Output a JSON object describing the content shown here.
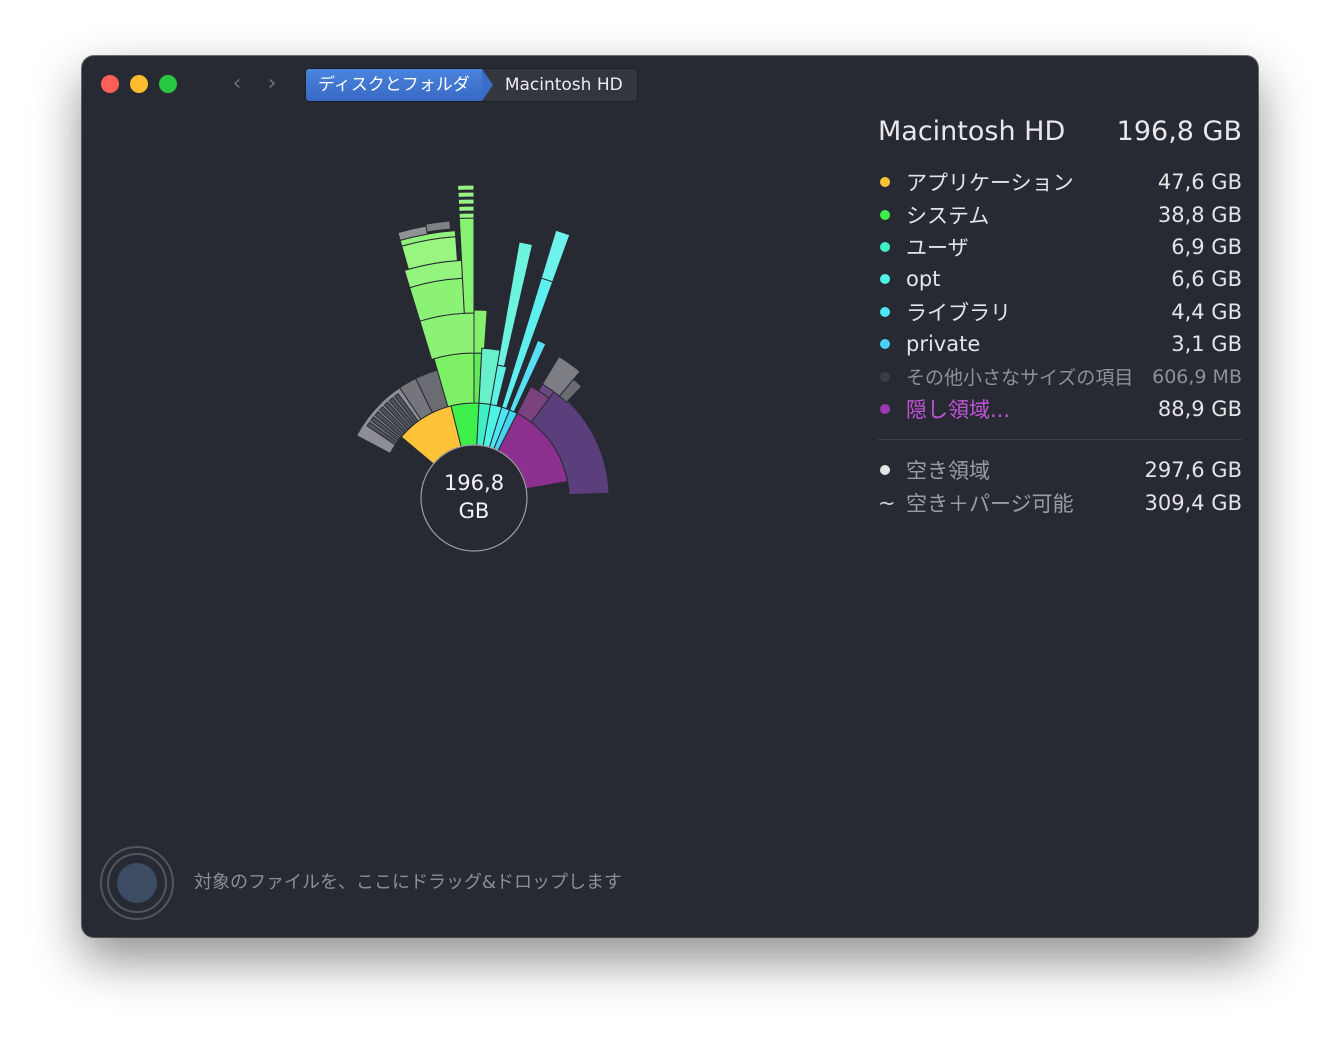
{
  "breadcrumb": {
    "root_label": "ディスクとフォルダ",
    "current_label": "Macintosh HD"
  },
  "chart": {
    "center_value": "196,8",
    "center_unit": "GB"
  },
  "panel": {
    "title": "Macintosh HD",
    "total": "196,8 GB",
    "items": [
      {
        "name": "アプリケーション",
        "size": "47,6 GB",
        "color": "#ffc33a"
      },
      {
        "name": "システム",
        "size": "38,8 GB",
        "color": "#3df04a"
      },
      {
        "name": "ユーザ",
        "size": "6,9 GB",
        "color": "#3ff0c6"
      },
      {
        "name": "opt",
        "size": "6,6 GB",
        "color": "#4ff3e6"
      },
      {
        "name": "ライブラリ",
        "size": "4,4 GB",
        "color": "#4fe6f3"
      },
      {
        "name": "private",
        "size": "3,1 GB",
        "color": "#45d3f0"
      },
      {
        "name": "その他小さなサイズの項目",
        "size": "606,9 MB",
        "color": "#3a3d45"
      },
      {
        "name": "隠し領域...",
        "size": "88,9 GB",
        "color": "#9d3ab0"
      }
    ],
    "free": {
      "name": "空き領域",
      "size": "297,6 GB",
      "color": "#e6e6e8"
    },
    "purgeable": {
      "symbol": "~",
      "name": "空き＋パージ可能",
      "size": "309,4 GB"
    }
  },
  "drop_hint": "対象のファイルを、ここにドラッグ&ドロップします",
  "colors": {
    "window_bg": "#282a33",
    "accent": "#3a6dc8",
    "close": "#fe5f57",
    "minimize": "#febc2e",
    "zoom": "#28c840"
  }
}
